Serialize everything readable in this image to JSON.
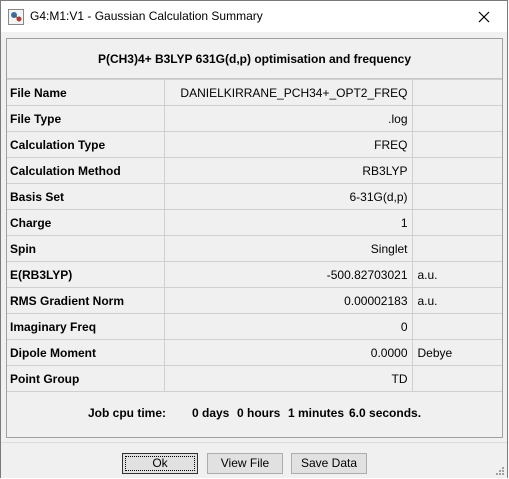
{
  "window": {
    "title": "G4:M1:V1 - Gaussian Calculation Summary"
  },
  "summary": {
    "heading": "P(CH3)4+ B3LYP 631G(d,p) optimisation and frequency",
    "rows": [
      {
        "label": "File Name",
        "value": "DANIELKIRRANE_PCH34+_OPT2_FREQ",
        "unit": ""
      },
      {
        "label": "File Type",
        "value": ".log",
        "unit": ""
      },
      {
        "label": "Calculation Type",
        "value": "FREQ",
        "unit": ""
      },
      {
        "label": "Calculation Method",
        "value": "RB3LYP",
        "unit": ""
      },
      {
        "label": "Basis Set",
        "value": "6-31G(d,p)",
        "unit": ""
      },
      {
        "label": "Charge",
        "value": "1",
        "unit": ""
      },
      {
        "label": "Spin",
        "value": "Singlet",
        "unit": ""
      },
      {
        "label": "E(RB3LYP)",
        "value": "-500.82703021",
        "unit": "a.u."
      },
      {
        "label": "RMS Gradient Norm",
        "value": "0.00002183",
        "unit": "a.u."
      },
      {
        "label": "Imaginary Freq",
        "value": "0",
        "unit": ""
      },
      {
        "label": "Dipole Moment",
        "value": "0.0000",
        "unit": "Debye"
      },
      {
        "label": "Point Group",
        "value": "TD",
        "unit": ""
      }
    ],
    "cpu": {
      "label": "Job cpu time:",
      "days": "0 days",
      "hours": "0 hours",
      "minutes": "1 minutes",
      "seconds": "6.0 seconds."
    }
  },
  "buttons": {
    "ok": "Ok",
    "view_file": "View File",
    "save_data": "Save Data"
  }
}
